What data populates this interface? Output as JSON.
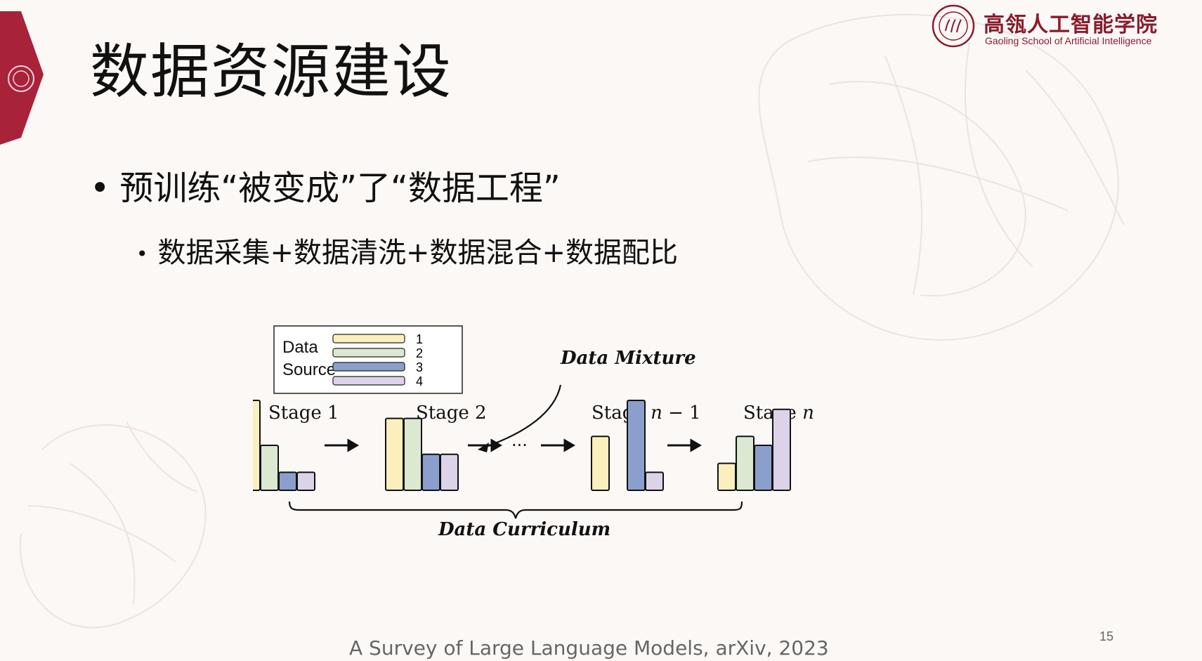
{
  "slide": {
    "title": "数据资源建设",
    "bullet1": "预训练“被变成”了“数据工程”",
    "bullet2": "数据采集+数据清洗+数据混合+数据配比",
    "bullet_symbol": "•",
    "citation": "A Survey of Large Language Models, arXiv, 2023",
    "page_number": "15"
  },
  "logo": {
    "name_cn": "高瓴人工智能学院",
    "name_en": "Gaoling School of Artificial Intelligence",
    "color": "#8a1c2b"
  },
  "diagram": {
    "legend": {
      "title_line1": "Data",
      "title_line2": "Source",
      "entries": [
        {
          "label": "1",
          "color": "#fbf0bd"
        },
        {
          "label": "2",
          "color": "#dbe9d2"
        },
        {
          "label": "3",
          "color": "#8a9fcc"
        },
        {
          "label": "4",
          "color": "#dcd3e9"
        }
      ]
    },
    "mixture_label": "Data Mixture",
    "curriculum_label": "Data Curriculum",
    "ellipsis": "···",
    "stages": [
      {
        "label": "Stage 1",
        "bars": [
          1.0,
          0.5,
          0.2,
          0.2
        ]
      },
      {
        "label": "Stage 2",
        "bars": [
          0.8,
          0.8,
          0.4,
          0.4
        ]
      },
      {
        "label": "Stage n − 1",
        "bars": [
          0.0,
          0.0,
          0.0,
          0.0
        ],
        "n_minus_1": [
          0.6,
          0.0,
          1.0,
          0.2
        ]
      },
      {
        "label": "Stage n",
        "bars": [
          0.3,
          0.6,
          0.5,
          0.9
        ]
      }
    ]
  }
}
